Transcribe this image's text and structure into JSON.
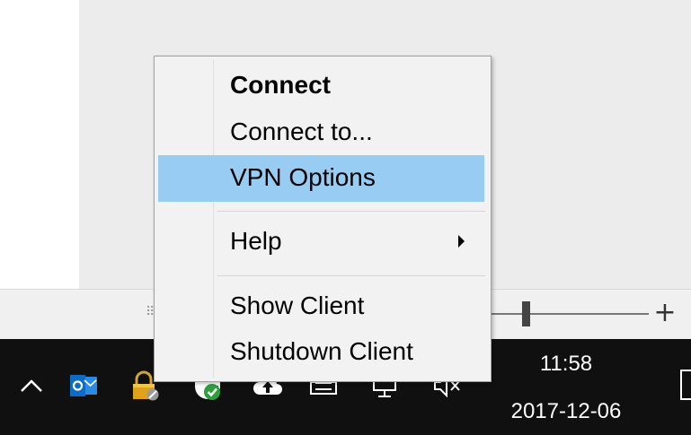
{
  "menu": {
    "items": [
      {
        "label": "Connect",
        "bold": true
      },
      {
        "label": "Connect to..."
      },
      {
        "label": "VPN Options",
        "highlighted": true
      },
      {
        "label": "Help",
        "has_submenu": true
      },
      {
        "label": "Show Client"
      },
      {
        "label": "Shutdown Client"
      }
    ]
  },
  "statusbar": {
    "zoom_plus": "+",
    "grip": "⠿"
  },
  "taskbar": {
    "clock_time": "11:58",
    "clock_date": "2017-12-06",
    "tray_icons": [
      "chevron-up-icon",
      "outlook-icon",
      "vpn-lock-icon",
      "shield-check-icon",
      "cloud-upload-icon",
      "printer-icon",
      "network-icon",
      "speaker-muted-icon"
    ]
  },
  "colors": {
    "menu_highlight": "#99ccf2",
    "taskbar": "#101010",
    "outlook_blue": "#0f6cc4",
    "vpn_gold": "#e0a21a",
    "shield_green": "#2e9e3e"
  }
}
